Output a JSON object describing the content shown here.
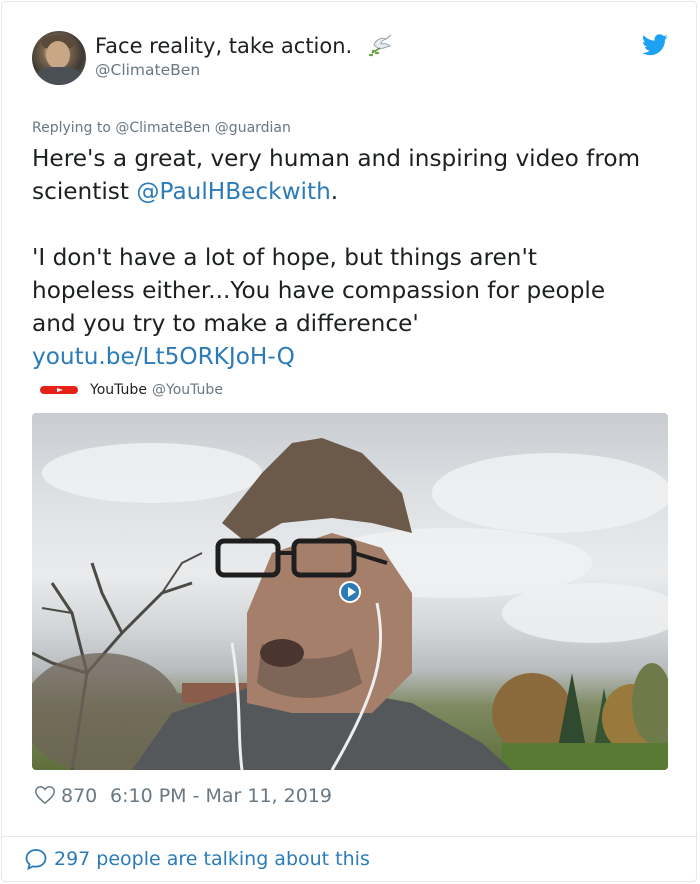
{
  "author": {
    "display_name": "Face reality, take action.",
    "handle": "@ClimateBen",
    "emoji_icon": "dove-with-olive-branch-icon",
    "platform_icon": "twitter-bird-icon"
  },
  "reply_context": {
    "prefix": "Replying to",
    "mentions": "@ClimateBen @guardian"
  },
  "tweet": {
    "line1": "Here's a great, very human and inspiring video from",
    "line2_prefix": "scientist ",
    "line2_mention": "@PaulHBeckwith",
    "line2_suffix": ".",
    "line3": "'I don't have a lot of hope, but things aren't",
    "line4": "hopeless either...You have compassion for people",
    "line5": "and you try to make a difference'",
    "link": "youtu.be/Lt5ORKJoH-Q"
  },
  "embed": {
    "source_name": "YouTube",
    "source_handle": "@YouTube"
  },
  "meta": {
    "likes": "870",
    "timestamp": "6:10 PM - Mar 11, 2019"
  },
  "footer": {
    "talking": "297 people are talking about this"
  },
  "colors": {
    "link": "#2b7bb9",
    "secondary_text": "#697882",
    "youtube_red": "#e62117",
    "twitter_blue": "#1da1f2"
  }
}
